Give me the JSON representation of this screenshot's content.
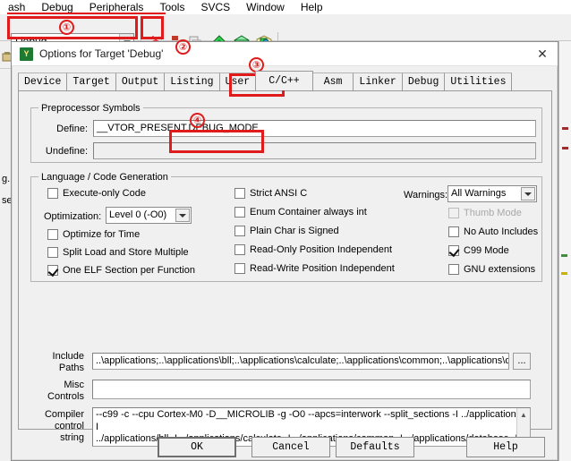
{
  "ide": {
    "menu_items": [
      "ash",
      "Debug",
      "Peripherals",
      "Tools",
      "SVCS",
      "Window",
      "Help"
    ],
    "target_combo": {
      "value": "Debug",
      "arrow_icon": "chevron-down-icon"
    },
    "toolbar_icons": [
      "target-options-magic-wand-icon",
      "build-target-icon",
      "batch-build-icon",
      "manage-components-icon",
      "manage-run-time-environment-icon",
      "manage-project-items-icon"
    ],
    "left_strip": {
      "icon": "project-window-icon",
      "fragments": [
        "g.",
        "se"
      ]
    }
  },
  "dialog": {
    "icon": "keil-target-options-icon",
    "title": "Options for Target 'Debug'",
    "close_label": "✕",
    "tabs": [
      {
        "label": "Device",
        "active": false
      },
      {
        "label": "Target",
        "active": false
      },
      {
        "label": "Output",
        "active": false
      },
      {
        "label": "Listing",
        "active": false
      },
      {
        "label": "User",
        "active": false
      },
      {
        "label": "C/C++",
        "active": true
      },
      {
        "label": "Asm",
        "active": false
      },
      {
        "label": "Linker",
        "active": false
      },
      {
        "label": "Debug",
        "active": false
      },
      {
        "label": "Utilities",
        "active": false
      }
    ],
    "preprocessor": {
      "legend": "Preprocessor Symbols",
      "define_label": "Define:",
      "define_value": "__VTOR_PRESENT,DEBUG_MODE",
      "undefine_label": "Undefine:",
      "undefine_value": "",
      "undefine_disabled": true
    },
    "language": {
      "legend": "Language / Code Generation",
      "left_column": [
        {
          "label": "Execute-only Code",
          "checked": false,
          "disabled": false
        },
        {
          "label": "Optimize for Time",
          "checked": false,
          "disabled": false
        },
        {
          "label": "Split Load and Store Multiple",
          "checked": false,
          "disabled": false
        },
        {
          "label": "One ELF Section per Function",
          "checked": true,
          "disabled": false
        }
      ],
      "optimization_label": "Optimization:",
      "optimization_value": "Level 0 (-O0)",
      "middle_column": [
        {
          "label": "Strict ANSI C",
          "checked": false,
          "disabled": false
        },
        {
          "label": "Enum Container always int",
          "checked": false,
          "disabled": false
        },
        {
          "label": "Plain Char is Signed",
          "checked": false,
          "disabled": false
        },
        {
          "label": "Read-Only Position Independent",
          "checked": false,
          "disabled": false
        },
        {
          "label": "Read-Write Position Independent",
          "checked": false,
          "disabled": false
        }
      ],
      "warnings_label": "Warnings:",
      "warnings_value": "All Warnings",
      "right_column": [
        {
          "label": "Thumb Mode",
          "checked": false,
          "disabled": true
        },
        {
          "label": "No Auto Includes",
          "checked": false,
          "disabled": false
        },
        {
          "label": "C99 Mode",
          "checked": true,
          "disabled": false
        },
        {
          "label": "GNU extensions",
          "checked": false,
          "disabled": false
        }
      ]
    },
    "include_paths": {
      "label_line1": "Include",
      "label_line2": "Paths",
      "value": "..\\applications;..\\applications\\bll;..\\applications\\calculate;..\\applications\\common;..\\applications\\data",
      "browse_label": "..."
    },
    "misc_controls": {
      "label_line1": "Misc",
      "label_line2": "Controls",
      "value": ""
    },
    "compiler_control": {
      "label_line1": "Compiler",
      "label_line2": "control",
      "label_line3": "string",
      "line1": "--c99 -c --cpu Cortex-M0 -D__MICROLIB -g -O0 --apcs=interwork --split_sections -I ../applications -I",
      "line2": "../applications/bll -I ../applications/calculate -I ../applications/common -I ../applications/database -I",
      "scroll_up_icon": "chevron-up-icon",
      "scroll_down_icon": "chevron-down-icon"
    },
    "buttons": {
      "ok": "OK",
      "cancel": "Cancel",
      "defaults": "Defaults",
      "help": "Help"
    }
  },
  "annotations": {
    "marker_1": "①",
    "marker_2": "②",
    "marker_3": "③",
    "marker_4": "④",
    "color": "#e01b1b"
  }
}
